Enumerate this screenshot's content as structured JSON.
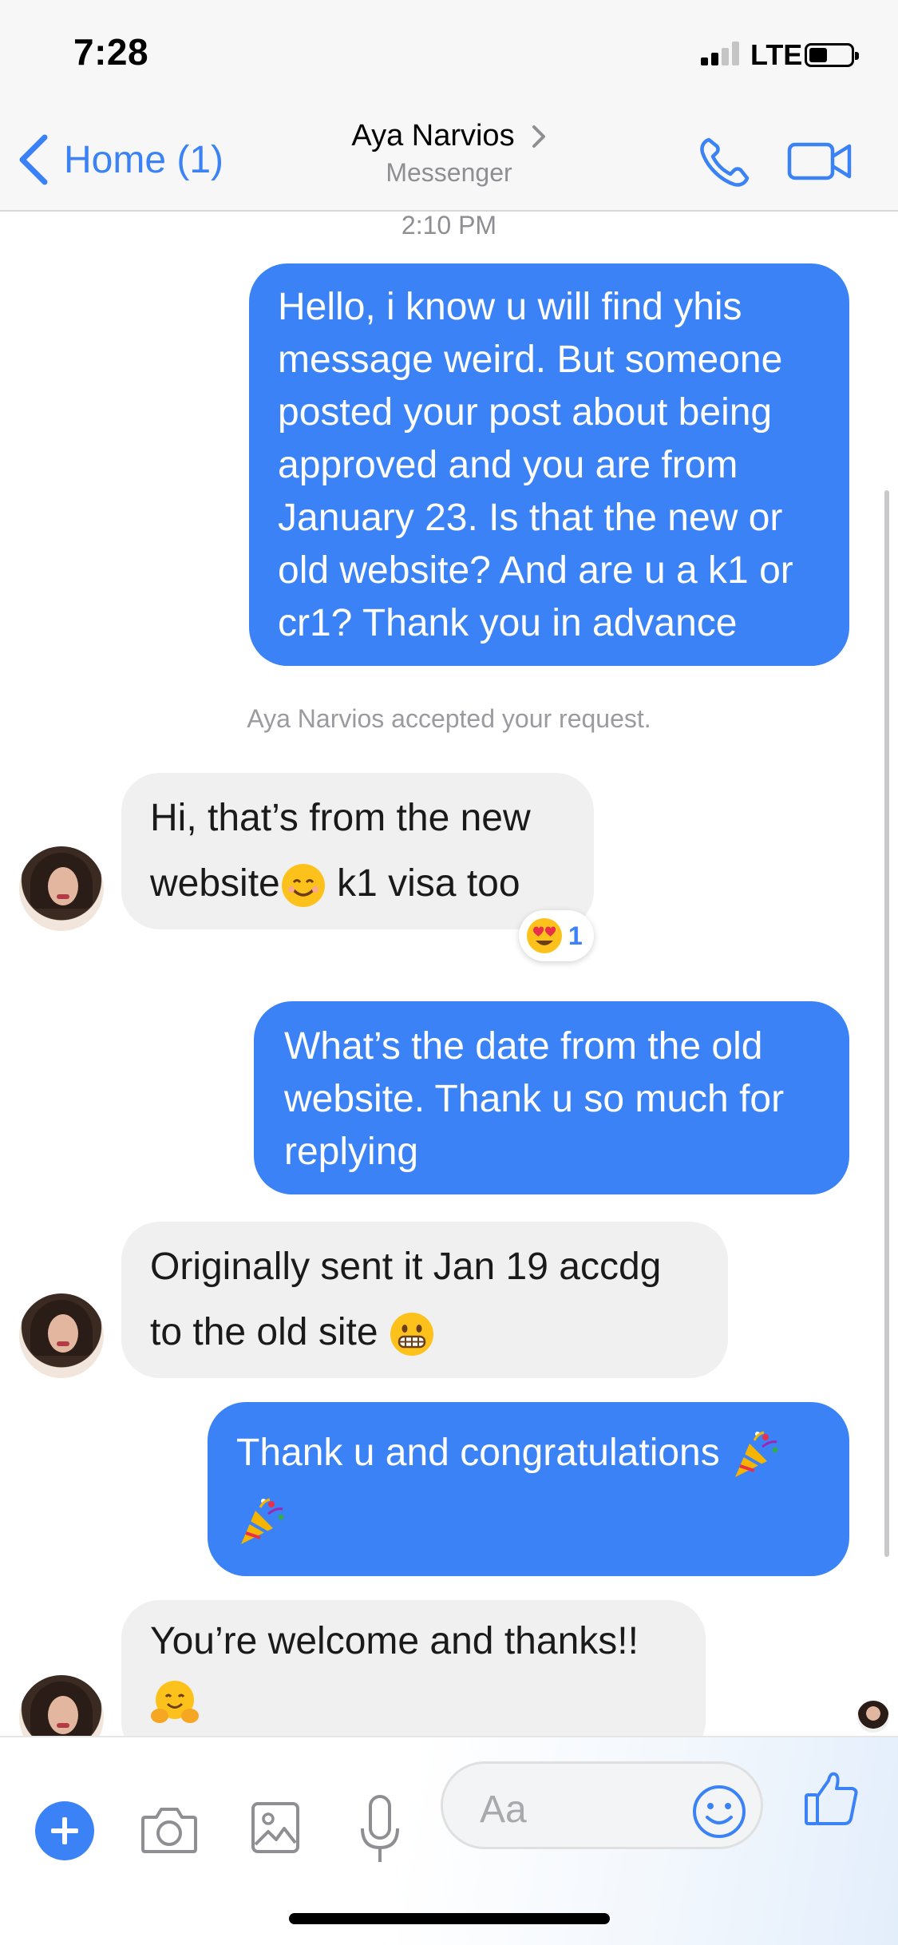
{
  "status_bar": {
    "time": "7:28",
    "network": "LTE"
  },
  "nav": {
    "back_label": "Home (1)",
    "contact_name": "Aya Narvios",
    "contact_subtitle": "Messenger",
    "accent_color": "#3b82f6"
  },
  "conversation": {
    "timestamp": "2:10 PM",
    "system_note": "Aya Narvios accepted your request.",
    "messages": [
      {
        "direction": "outgoing",
        "lines": [
          "Hello, i know u will find yhis",
          "message weird. But someone",
          "posted your post about being",
          "approved and you are from",
          "January 23. Is that the new or",
          "old website? And are u a k1 or",
          "cr1? Thank you in advance"
        ]
      },
      {
        "direction": "incoming",
        "lines": [
          "Hi, that’s from the new",
          "website",
          " k1 visa too"
        ],
        "emoji": "smiling-face-icon"
      },
      {
        "direction": "outgoing",
        "lines": [
          "What’s the date from the old",
          "website. Thank u so much for",
          "replying"
        ]
      },
      {
        "direction": "incoming",
        "lines": [
          "Originally sent it Jan 19 accdg",
          "to the old site"
        ],
        "emoji": "grimacing-face-icon"
      },
      {
        "direction": "outgoing",
        "lines": [
          "Thank u and congratulations"
        ],
        "emoji": "party-popper-icon"
      },
      {
        "direction": "incoming",
        "lines": [
          "You’re welcome and thanks!!"
        ],
        "emoji": "hugging-face-icon"
      }
    ],
    "reaction": {
      "emoji": "heart-eyes-icon",
      "count": "1"
    }
  },
  "composer": {
    "placeholder": "Aa",
    "icons": [
      "plus-icon",
      "camera-icon",
      "gallery-icon",
      "microphone-icon",
      "smiley-icon",
      "thumbs-up-icon"
    ]
  }
}
